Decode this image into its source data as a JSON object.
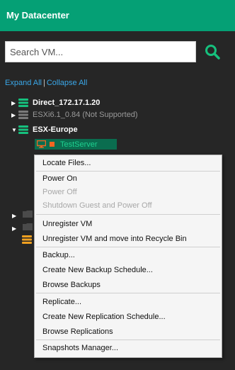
{
  "header": {
    "title": "My Datacenter"
  },
  "search": {
    "placeholder": "Search VM..."
  },
  "tree_controls": {
    "expand_all": "Expand All",
    "separator": "|",
    "collapse_all": "Collapse All"
  },
  "tree": {
    "hosts": [
      {
        "label": "Direct_172.17.1.20",
        "status": "normal",
        "expanded": false
      },
      {
        "label": "ESXi6.1_0.84 (Not Supported)",
        "status": "unsupported",
        "expanded": false
      },
      {
        "label": "ESX-Europe",
        "status": "normal",
        "expanded": true
      }
    ],
    "selected_vm": {
      "label": "TestServer"
    }
  },
  "context_menu": {
    "items": [
      {
        "label": "Locate Files...",
        "enabled": true
      },
      {
        "label": "Power On",
        "enabled": true
      },
      {
        "label": "Power Off",
        "enabled": false
      },
      {
        "label": "Shutdown Guest and Power Off",
        "enabled": false
      },
      {
        "label": "Unregister VM",
        "enabled": true
      },
      {
        "label": "Unregister VM and move into Recycle Bin",
        "enabled": true
      },
      {
        "label": "Backup...",
        "enabled": true
      },
      {
        "label": "Create New Backup Schedule...",
        "enabled": true
      },
      {
        "label": "Browse Backups",
        "enabled": true
      },
      {
        "label": "Replicate...",
        "enabled": true
      },
      {
        "label": "Create New Replication Schedule...",
        "enabled": true
      },
      {
        "label": "Browse Replications",
        "enabled": true
      },
      {
        "label": "Snapshots Manager...",
        "enabled": true
      }
    ]
  },
  "colors": {
    "header_bg": "#05a075",
    "accent_green": "#16c07d",
    "link_blue": "#3aa7e8",
    "unsupported_host": "#7a7a7a",
    "warning_host": "#f0a020",
    "vm_icon": "#f26522"
  },
  "icons": {
    "search": "search-icon",
    "host": "server-stack-icon",
    "vm": "monitor-icon",
    "vm_state": "stopped-square-icon",
    "folder": "folder-icon"
  }
}
